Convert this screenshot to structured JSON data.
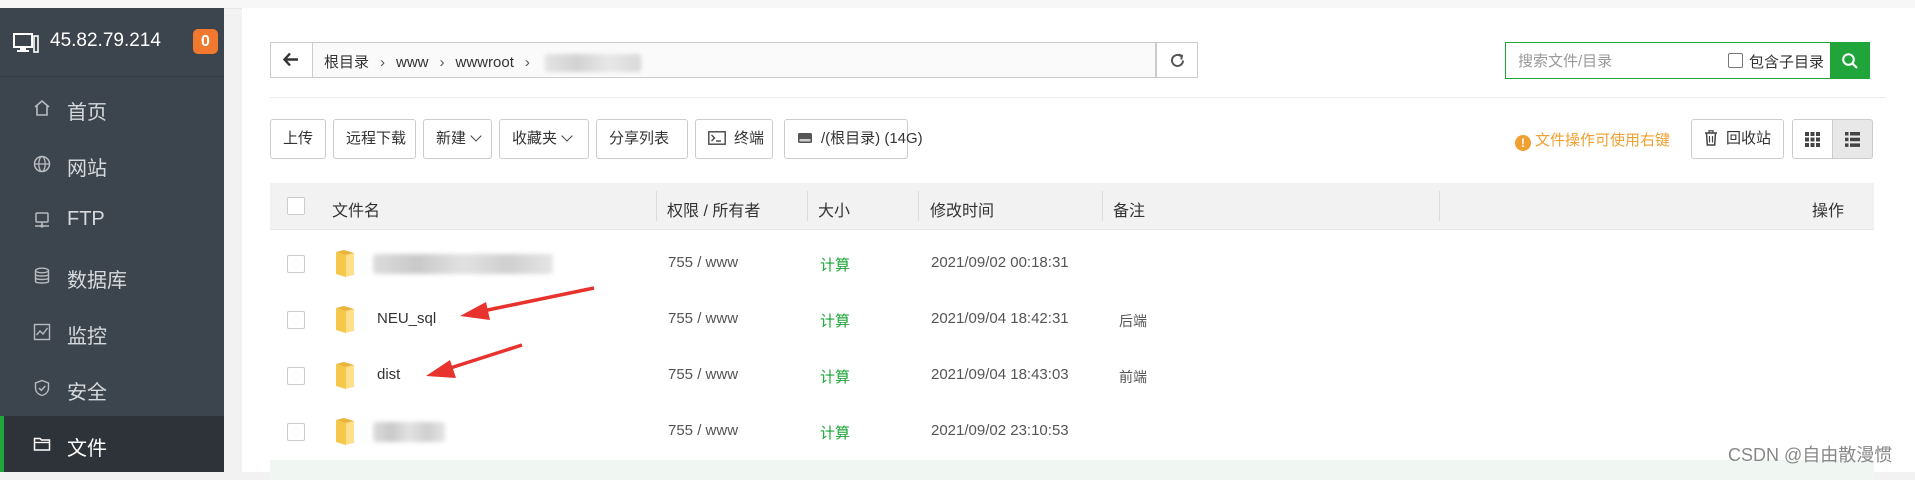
{
  "sidebar": {
    "ip": "45.82.79.214",
    "badge": "0",
    "items": [
      {
        "label": "首页",
        "icon": "home-icon"
      },
      {
        "label": "网站",
        "icon": "globe-icon"
      },
      {
        "label": "FTP",
        "icon": "ftp-icon"
      },
      {
        "label": "数据库",
        "icon": "database-icon"
      },
      {
        "label": "监控",
        "icon": "monitor-chart-icon"
      },
      {
        "label": "安全",
        "icon": "shield-icon"
      },
      {
        "label": "文件",
        "icon": "folder-icon",
        "active": true
      }
    ]
  },
  "path": {
    "crumbs": [
      "根目录",
      "www",
      "wwwroot"
    ]
  },
  "search": {
    "placeholder": "搜索文件/目录",
    "include_subdirs_label": "包含子目录"
  },
  "toolbar": {
    "upload": "上传",
    "remote_download": "远程下载",
    "new": "新建",
    "favorites": "收藏夹",
    "share_list": "分享列表",
    "terminal": "终端",
    "disk": "/(根目录) (14G)",
    "hint": "文件操作可使用右键",
    "recycle_bin": "回收站"
  },
  "table": {
    "headers": {
      "name": "文件名",
      "permission": "权限 / 所有者",
      "size": "大小",
      "mtime": "修改时间",
      "note": "备注",
      "actions": "操作"
    },
    "rows": [
      {
        "name": "",
        "perm": "755 / www",
        "size": "计算",
        "mtime": "2021/09/02 00:18:31",
        "note": ""
      },
      {
        "name": "NEU_sql",
        "perm": "755 / www",
        "size": "计算",
        "mtime": "2021/09/04 18:42:31",
        "note": "后端"
      },
      {
        "name": "dist",
        "perm": "755 / www",
        "size": "计算",
        "mtime": "2021/09/04 18:43:03",
        "note": "前端"
      },
      {
        "name": "",
        "perm": "755 / www",
        "size": "计算",
        "mtime": "2021/09/02 23:10:53",
        "note": ""
      }
    ]
  },
  "colors": {
    "accent": "#20a53a",
    "sidebar_bg": "#3c444d",
    "badge": "#f0782f",
    "hint": "#f0a030",
    "annotation_arrow": "#e8322d"
  },
  "watermark": "CSDN @自由散漫惯"
}
